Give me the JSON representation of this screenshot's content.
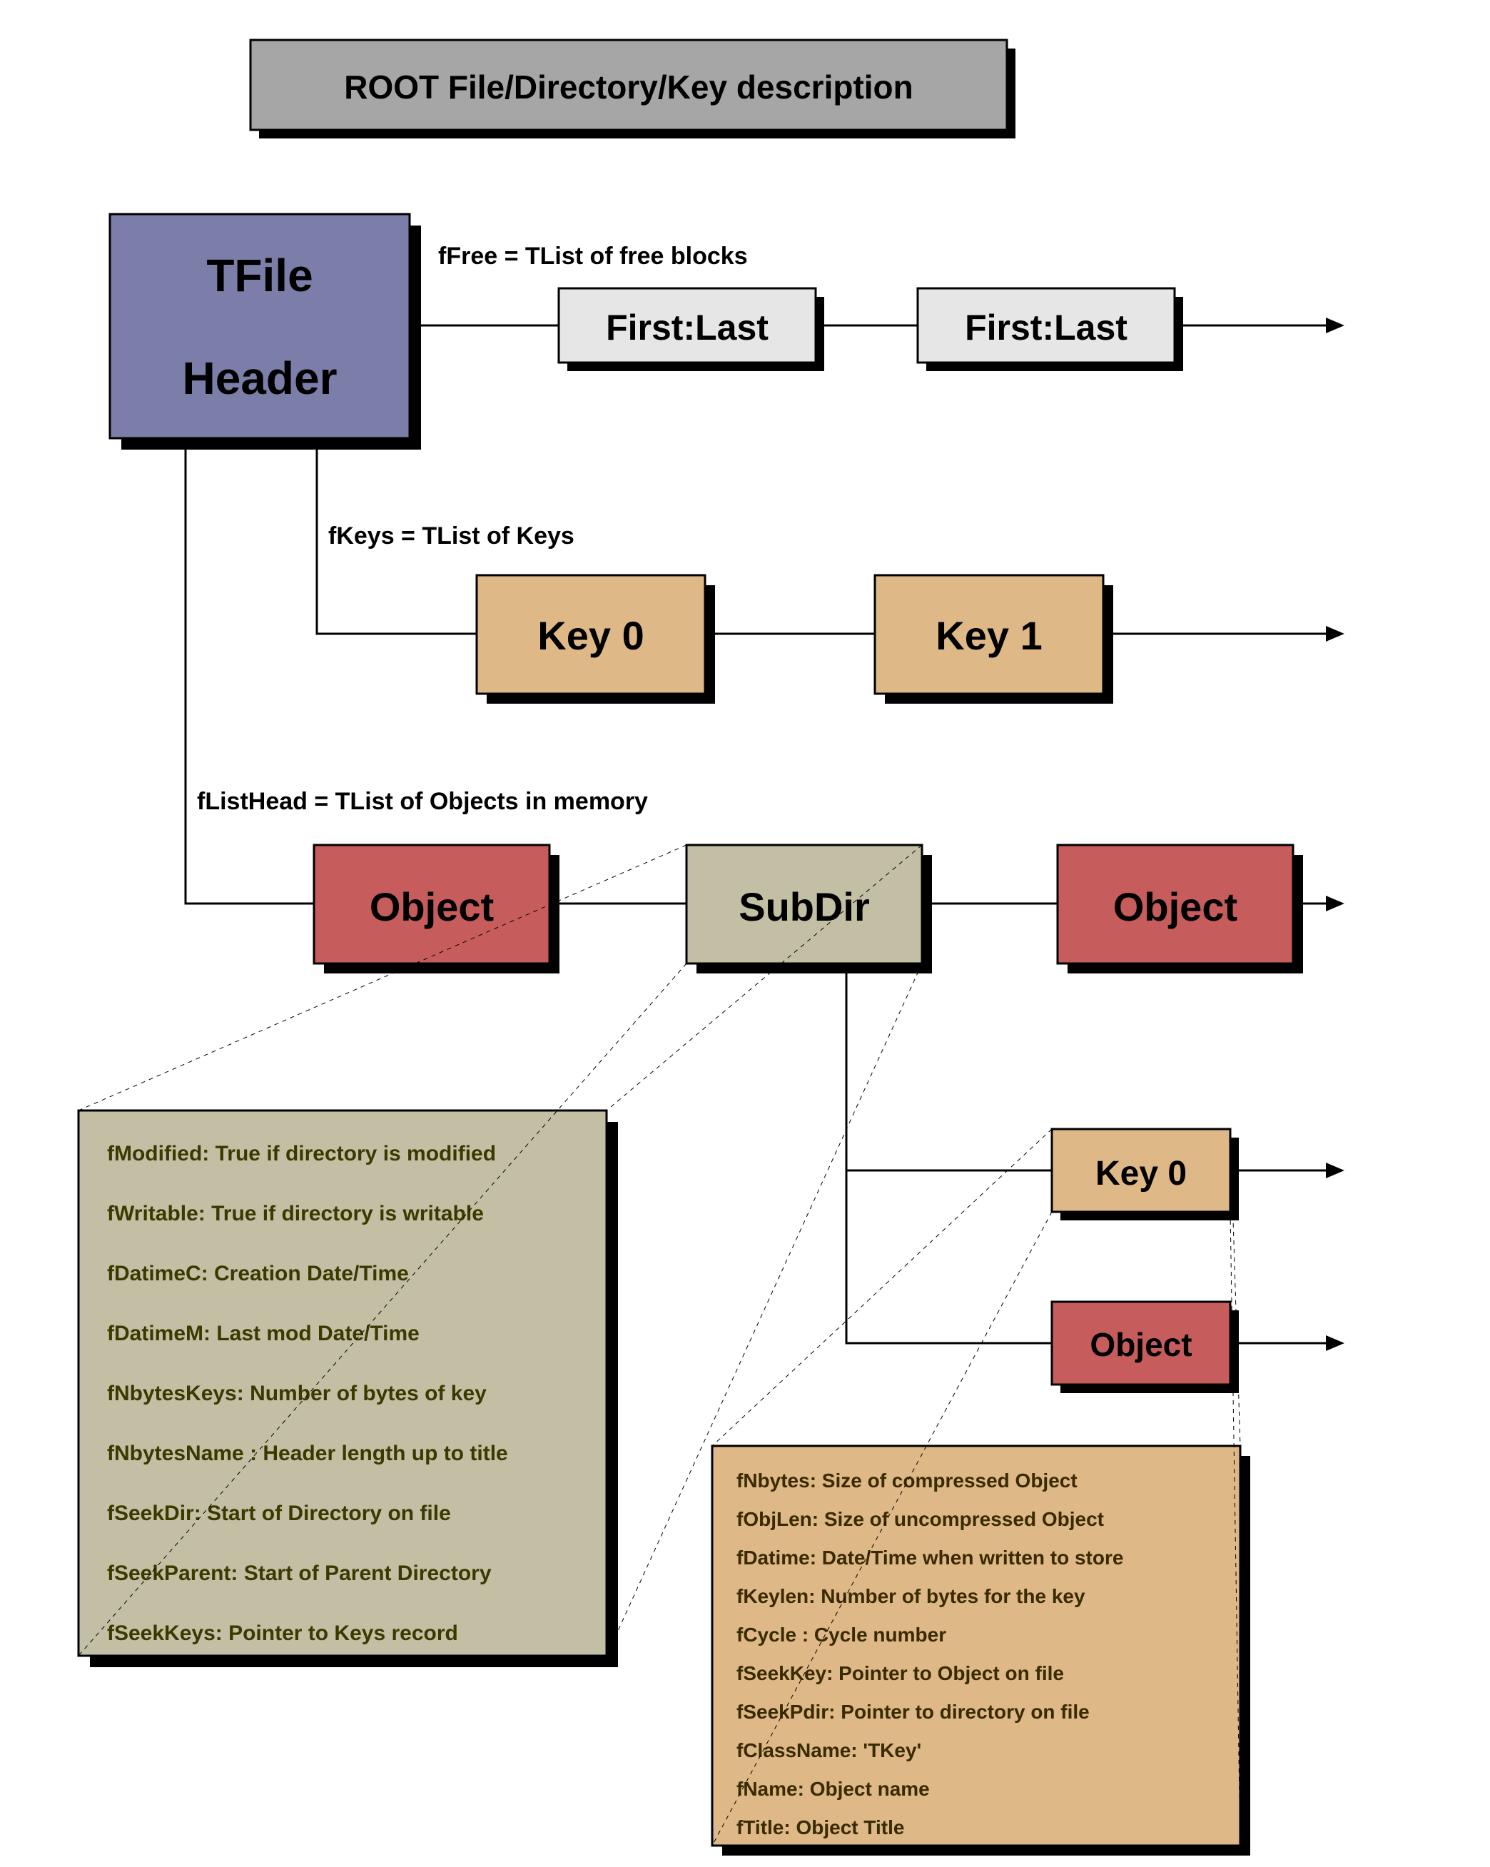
{
  "title": "ROOT File/Directory/Key description",
  "tfile": {
    "line1": "TFile",
    "line2": "Header"
  },
  "labels": {
    "fFree": "fFree = TList of free blocks",
    "fKeys": "fKeys = TList of Keys",
    "fListHead": "fListHead = TList of Objects in memory"
  },
  "free": {
    "a": "First:Last",
    "b": "First:Last"
  },
  "keys": {
    "k0": "Key 0",
    "k1": "Key 1",
    "sub_k0": "Key 0"
  },
  "objects": {
    "a": "Object",
    "b": "SubDir",
    "c": "Object",
    "sub_obj": "Object"
  },
  "dir_fields": [
    "fModified: True if directory is modified",
    "fWritable: True if directory is writable",
    "fDatimeC: Creation Date/Time",
    "fDatimeM: Last mod Date/Time",
    "fNbytesKeys: Number of bytes of key",
    "fNbytesName : Header length up to title",
    "fSeekDir: Start of Directory on file",
    "fSeekParent: Start of Parent Directory",
    "fSeekKeys: Pointer to Keys record"
  ],
  "key_fields": [
    "fNbytes: Size of compressed Object",
    "fObjLen: Size of uncompressed Object",
    "fDatime: Date/Time when written to store",
    "fKeylen: Number of bytes for the key",
    "fCycle : Cycle number",
    "fSeekKey: Pointer to Object on file",
    "fSeekPdir: Pointer to directory on file",
    "fClassName: 'TKey'",
    "fName: Object name",
    "fTitle: Object Title"
  ]
}
